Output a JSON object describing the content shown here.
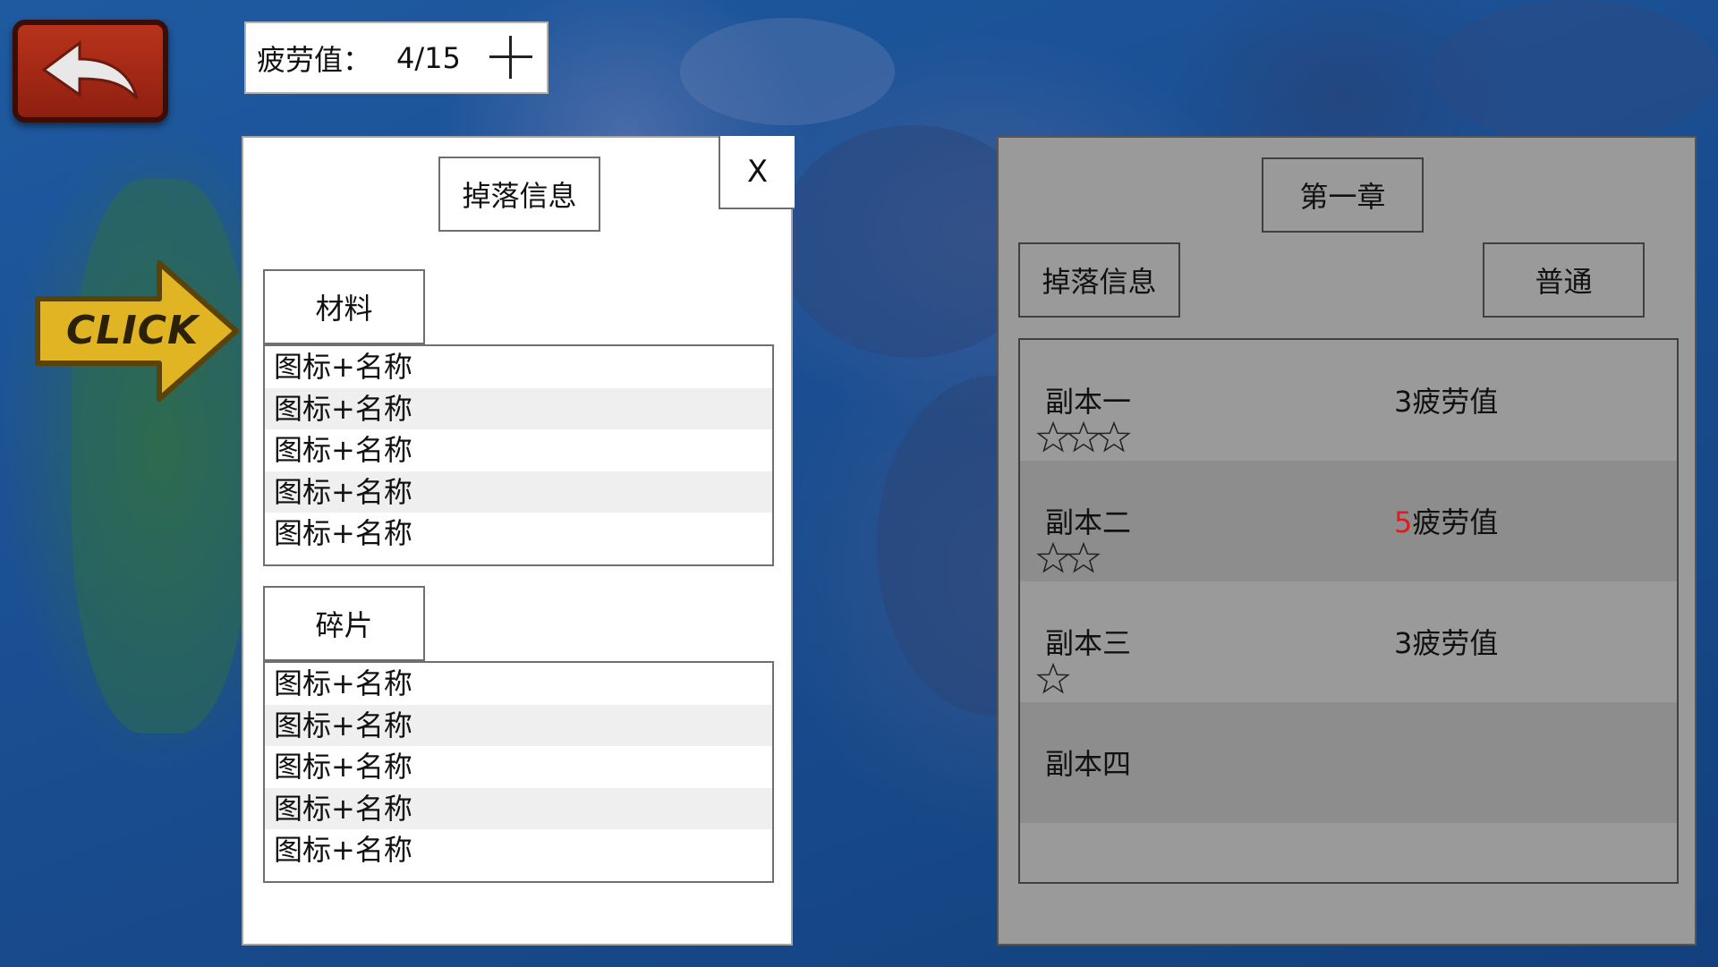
{
  "fatigue": {
    "label": "疲劳值：",
    "value": "4/15"
  },
  "decor": {
    "click_text": "CLICK"
  },
  "drop_panel": {
    "title": "掉落信息",
    "close_label": "X",
    "categories": [
      {
        "label": "材料",
        "items": [
          "图标+名称",
          "图标+名称",
          "图标+名称",
          "图标+名称",
          "图标+名称"
        ]
      },
      {
        "label": "碎片",
        "items": [
          "图标+名称",
          "图标+名称",
          "图标+名称",
          "图标+名称",
          "图标+名称"
        ]
      }
    ]
  },
  "chapter_panel": {
    "title": "第一章",
    "drop_button": "掉落信息",
    "mode_button": "普通",
    "stages": [
      {
        "name": "副本一",
        "cost_num": "3",
        "cost_unit": "疲劳值",
        "cost_highlight": false,
        "stars": 3
      },
      {
        "name": "副本二",
        "cost_num": "5",
        "cost_unit": "疲劳值",
        "cost_highlight": true,
        "stars": 2
      },
      {
        "name": "副本三",
        "cost_num": "3",
        "cost_unit": "疲劳值",
        "cost_highlight": false,
        "stars": 1
      },
      {
        "name": "副本四",
        "cost_num": "",
        "cost_unit": "",
        "cost_highlight": false,
        "stars": 0
      }
    ]
  },
  "colors": {
    "highlight_cost": "#e21a1a",
    "back_button": "#b8331b",
    "panel_gray": "#9a9a9a"
  }
}
